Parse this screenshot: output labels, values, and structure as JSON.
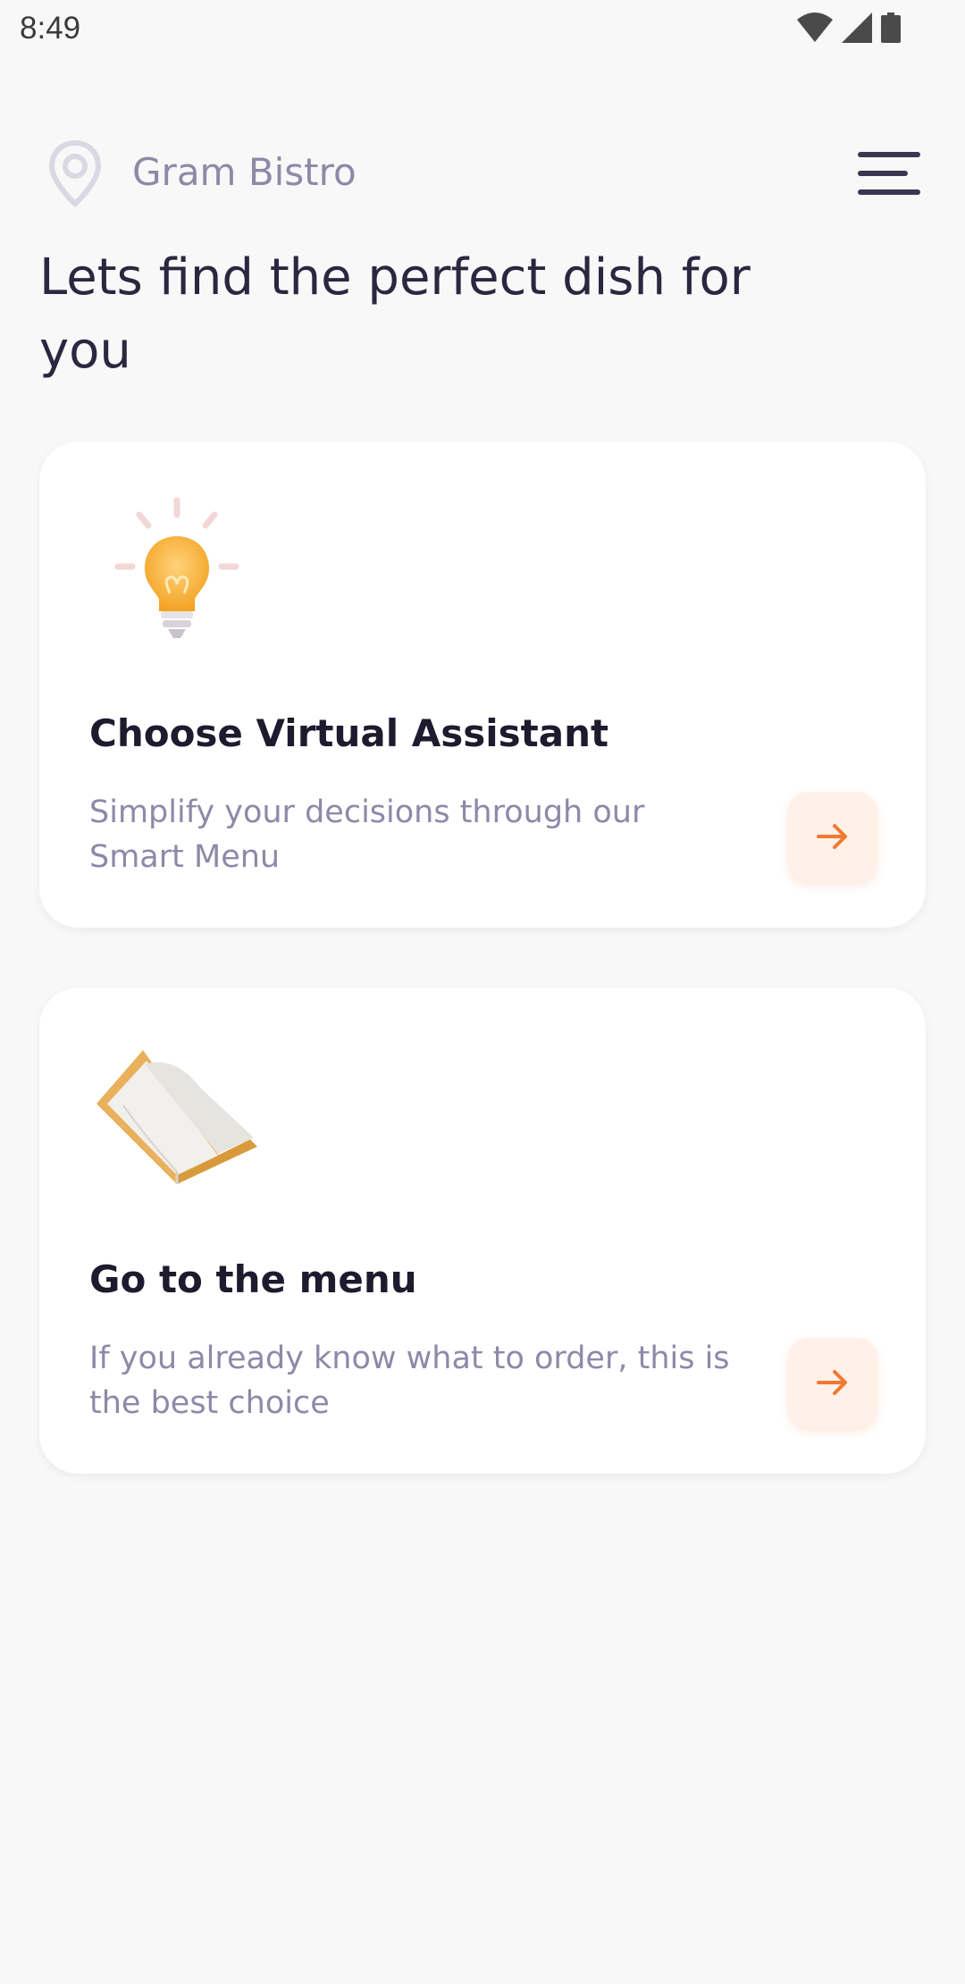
{
  "status_bar": {
    "time": "8:49",
    "icons": [
      "wifi-icon",
      "signal-icon",
      "battery-icon"
    ]
  },
  "header": {
    "location_icon": "location-pin-icon",
    "restaurant_name": "Gram Bistro",
    "menu_icon": "hamburger-menu-icon"
  },
  "heading": "Lets find the perfect dish for you",
  "cards": [
    {
      "illustration": "lightbulb-illustration",
      "title": "Choose Virtual Assistant",
      "description": "Simplify your decisions through our Smart Menu",
      "action_icon": "arrow-right-icon"
    },
    {
      "illustration": "open-book-illustration",
      "title": "Go to the menu",
      "description": "If you already know what to order, this is the best choice",
      "action_icon": "arrow-right-icon"
    }
  ],
  "colors": {
    "background": "#f8f8f8",
    "accent": "#f37830",
    "accent_light": "#fff1e8",
    "text_dark": "#2a2740",
    "text_muted": "#8c8aa8"
  }
}
